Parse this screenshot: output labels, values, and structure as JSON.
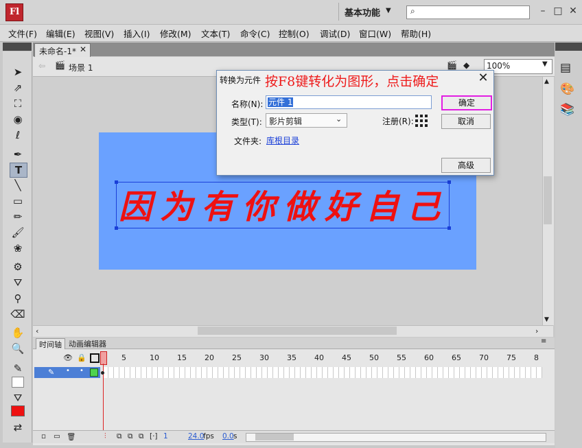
{
  "app": {
    "logo": "Fl",
    "workspace": "基本功能",
    "search_placeholder": ""
  },
  "menu": [
    "文件(F)",
    "编辑(E)",
    "视图(V)",
    "插入(I)",
    "修改(M)",
    "文本(T)",
    "命令(C)",
    "控制(O)",
    "调试(D)",
    "窗口(W)",
    "帮助(H)"
  ],
  "document": {
    "tab_title": "未命名-1*",
    "scene": "场景 1",
    "zoom": "100%"
  },
  "stage": {
    "text": "因为有你做好自己",
    "text_color": "#ee1111",
    "stage_color": "#6aa1ff"
  },
  "dialog": {
    "title": "转换为元件",
    "annotation": "按F8键转化为图形，点击确定",
    "name_label": "名称(N):",
    "name_value": "元件 1",
    "type_label": "类型(T):",
    "type_value": "影片剪辑",
    "register_label": "注册(R):",
    "folder_label": "文件夹:",
    "folder_link": "库根目录",
    "ok": "确定",
    "cancel": "取消",
    "advanced": "高级"
  },
  "timeline": {
    "tab_timeline": "时间轴",
    "tab_motion": "动画编辑器",
    "frame_numbers": [
      "1",
      "5",
      "10",
      "15",
      "20",
      "25",
      "30",
      "35",
      "40",
      "45",
      "50",
      "55",
      "60",
      "65",
      "70",
      "75",
      "8"
    ],
    "current_frame": "1",
    "fps": "24.0",
    "fps_unit": "fps",
    "time": "0.0",
    "time_unit": "s"
  },
  "colors": {
    "stroke": "#333333",
    "fill": "#ee1111",
    "highlight_button_border": "#e21de2"
  }
}
